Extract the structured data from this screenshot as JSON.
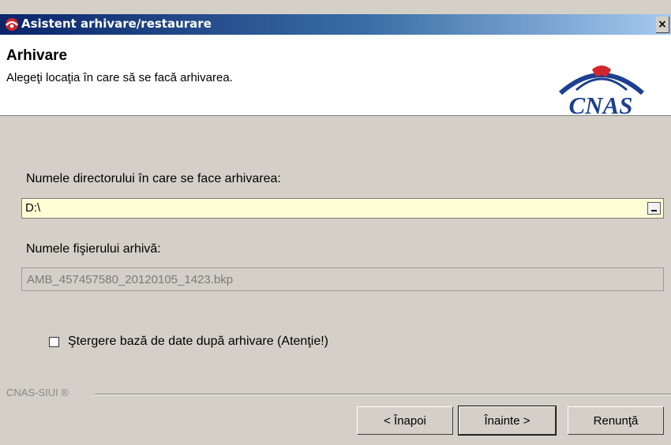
{
  "window": {
    "title": "Asistent arhivare/restaurare",
    "close_glyph": "×"
  },
  "header": {
    "title": "Arhivare",
    "subtitle": "Alegeţi locaţia în care să se facă arhivarea.",
    "logo_text": "CNAS"
  },
  "form": {
    "dir_label": "Numele directorului în care se face arhivarea:",
    "dir_value": "D:\\",
    "file_label": "Numele fişierului arhivă:",
    "file_value": "AMB_457457580_20120105_1423.bkp",
    "delete_checkbox_label": "Ştergere bază de date după arhivare (Atenţie!)",
    "delete_checked": false
  },
  "footer": {
    "brand": "CNAS-SIUI ®",
    "back_label": "< Înapoi",
    "next_label": "Înainte >",
    "cancel_label": "Renunţă"
  },
  "colors": {
    "titlebar_start": "#0a246a",
    "titlebar_end": "#a6caf0",
    "input_highlight": "#ffffd6",
    "logo_blue": "#1c3f8f",
    "logo_red": "#d0262d"
  },
  "icons": {
    "title_icon": "cnas-app-icon",
    "dir_browse": "browse-icon",
    "logo": "cnas-logo"
  }
}
